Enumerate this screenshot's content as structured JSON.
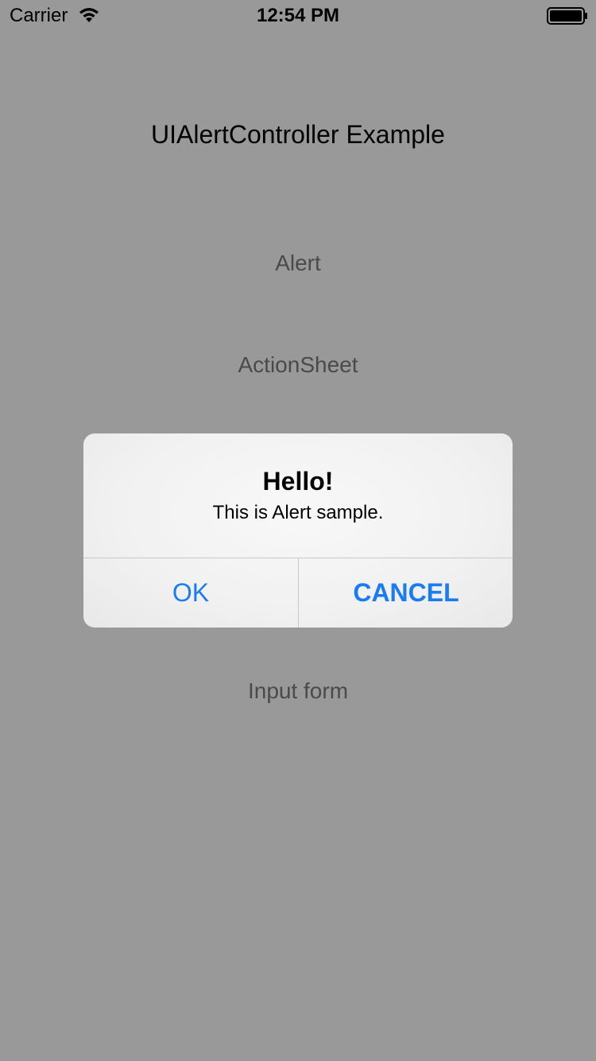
{
  "status_bar": {
    "carrier": "Carrier",
    "time": "12:54 PM",
    "wifi_icon": "wifi-icon",
    "battery_icon": "battery-icon"
  },
  "page": {
    "title": "UIAlertController Example",
    "buttons": {
      "alert": "Alert",
      "action_sheet": "ActionSheet",
      "input_form": "Input form"
    }
  },
  "alert": {
    "title": "Hello!",
    "message": "This is Alert sample.",
    "ok_label": "OK",
    "cancel_label": "CANCEL"
  },
  "colors": {
    "dim_background": "#999999",
    "accent": "#1a7cf5",
    "dimmed_text": "#4a4a4a"
  }
}
